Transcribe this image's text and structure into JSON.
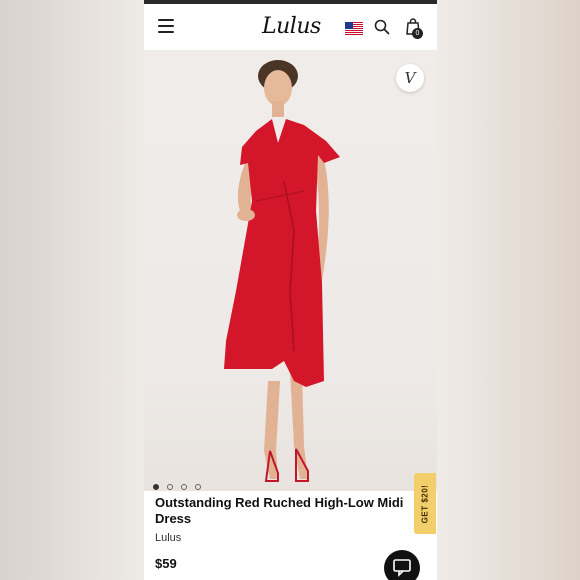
{
  "header": {
    "logo_text": "Lulus",
    "menu_icon": "hamburger-menu-icon",
    "flag_icon": "us-flag-icon",
    "search_icon": "search-icon",
    "bag_icon": "shopping-bag-icon",
    "bag_count": "0"
  },
  "product": {
    "favorite_icon": "heart-v-icon",
    "favorite_glyph": "V",
    "image_count": 4,
    "active_image": 1,
    "title": "Outstanding Red Ruched High-Low Midi Dress",
    "brand": "Lulus",
    "price": "$59"
  },
  "promo": {
    "label": "GET $20!",
    "color": "#f3cf6c"
  },
  "chat": {
    "icon": "chat-bubble-icon"
  },
  "colors": {
    "dress": "#d4162a",
    "accent": "#111111"
  }
}
